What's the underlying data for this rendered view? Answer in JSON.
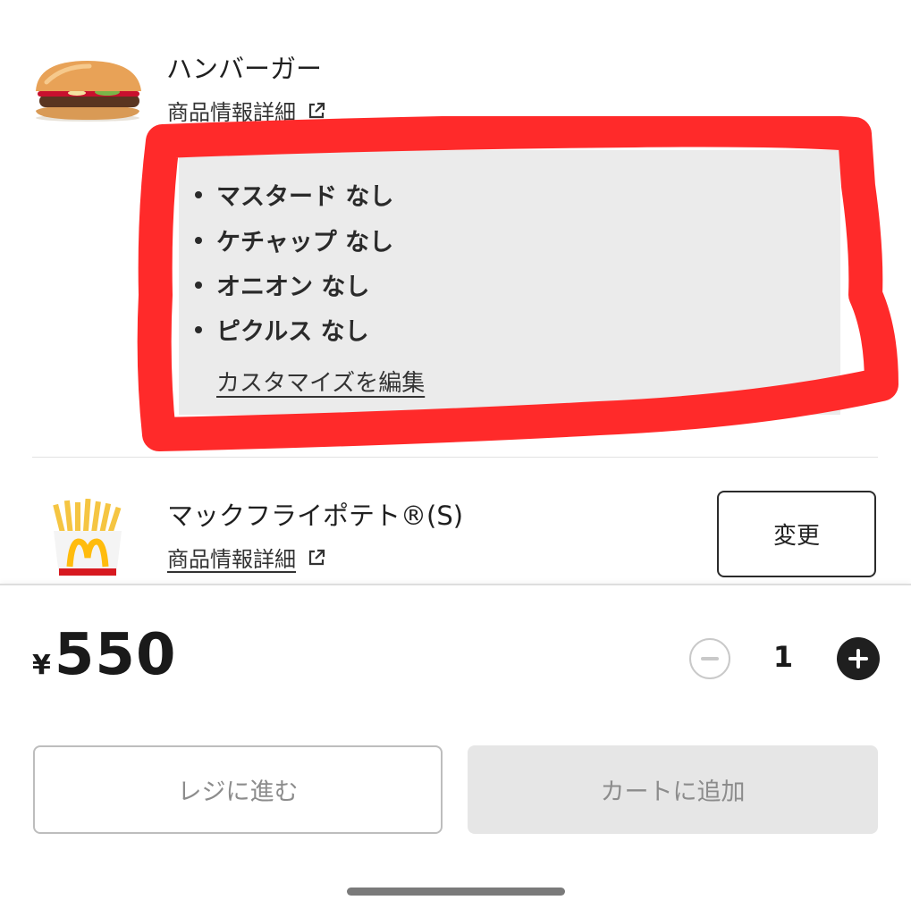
{
  "items": [
    {
      "name": "ハンバーガー",
      "detail_link": "商品情報詳細",
      "options": [
        "マスタード なし",
        "ケチャップ なし",
        "オニオン なし",
        "ピクルス なし"
      ],
      "edit_custom": "カスタマイズを編集"
    },
    {
      "name": "マックフライポテト®(S)",
      "detail_link": "商品情報詳細",
      "change_label": "変更"
    }
  ],
  "price": {
    "currency": "¥",
    "amount": "550"
  },
  "quantity": "1",
  "buttons": {
    "checkout": "レジに進む",
    "add_to_cart": "カートに追加"
  },
  "colors": {
    "highlight": "#ff2a2a",
    "custom_bg": "#ebebeb",
    "mcd_red": "#d71920",
    "mcd_yellow": "#ffbc0d"
  }
}
